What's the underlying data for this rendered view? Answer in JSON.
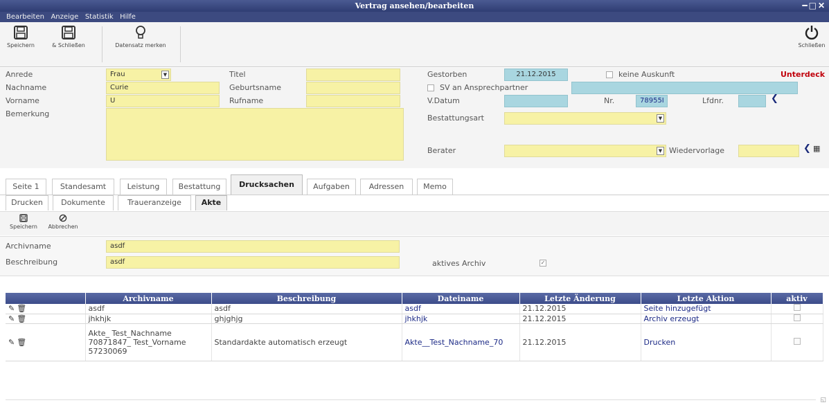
{
  "window": {
    "title": "Vertrag ansehen/bearbeiten",
    "controls": "━□✕"
  },
  "menu": [
    "Bearbeiten",
    "Anzeige",
    "Statistik",
    "Hilfe"
  ],
  "toolbar": {
    "save": "Speichern",
    "save_close": "& Schließen",
    "bookmark": "Datensatz merken",
    "close": "Schließen"
  },
  "form": {
    "anrede_label": "Anrede",
    "anrede_value": "Frau",
    "nachname_label": "Nachname",
    "nachname_value": "Curie",
    "vorname_label": "Vorname",
    "vorname_value": "U",
    "bemerkung_label": "Bemerkung",
    "titel_label": "Titel",
    "geburtsname_label": "Geburtsname",
    "rufname_label": "Rufname",
    "gestorben_label": "Gestorben",
    "gestorben_value": "21.12.2015",
    "keine_auskunft_label": "keine Auskunft",
    "unterdeck_text": "Unterdeck",
    "sv_label": "SV an Ansprechpartner",
    "vdatum_label": "V.Datum",
    "nr_label": "Nr.",
    "nr_value": "78955I",
    "lfdnr_label": "Lfdnr.",
    "bestattungsart_label": "Bestattungsart",
    "berater_label": "Berater",
    "wiedervorlage_label": "Wiedervorlage"
  },
  "tabs": [
    "Seite 1",
    "Standesamt",
    "Leistung",
    "Bestattung",
    "Drucksachen",
    "Aufgaben",
    "Adressen",
    "Memo"
  ],
  "subtabs": [
    "Drucken",
    "Dokumente",
    "Traueranzeige",
    "Akte"
  ],
  "subtoolbar": {
    "save": "Speichern",
    "cancel": "Abbrechen"
  },
  "detail": {
    "archivname_label": "Archivname",
    "archivname_value": "asdf",
    "beschreibung_label": "Beschreibung",
    "beschreibung_value": "asdf",
    "aktiv_label": "aktives Archiv"
  },
  "grid": {
    "headers": [
      "",
      "Archivname",
      "Beschreibung",
      "Dateiname",
      "Letzte Änderung",
      "Letzte Aktion",
      "aktiv"
    ],
    "rows": [
      {
        "archivname": "asdf",
        "beschreibung": "asdf",
        "dateiname": "asdf",
        "aenderung": "21.12.2015",
        "aktion": "Seite hinzugefügt"
      },
      {
        "archivname": "jhkhjk",
        "beschreibung": "ghjghjg",
        "dateiname": "jhkhjk",
        "aenderung": "21.12.2015",
        "aktion": "Archiv erzeugt"
      },
      {
        "archivname": "Akte_ Test_Nachname 70871847_ Test_Vorname 57230069",
        "beschreibung": "Standardakte automatisch erzeugt",
        "dateiname": "Akte__Test_Nachname_70",
        "aenderung": "21.12.2015",
        "aktion": "Drucken"
      }
    ]
  }
}
